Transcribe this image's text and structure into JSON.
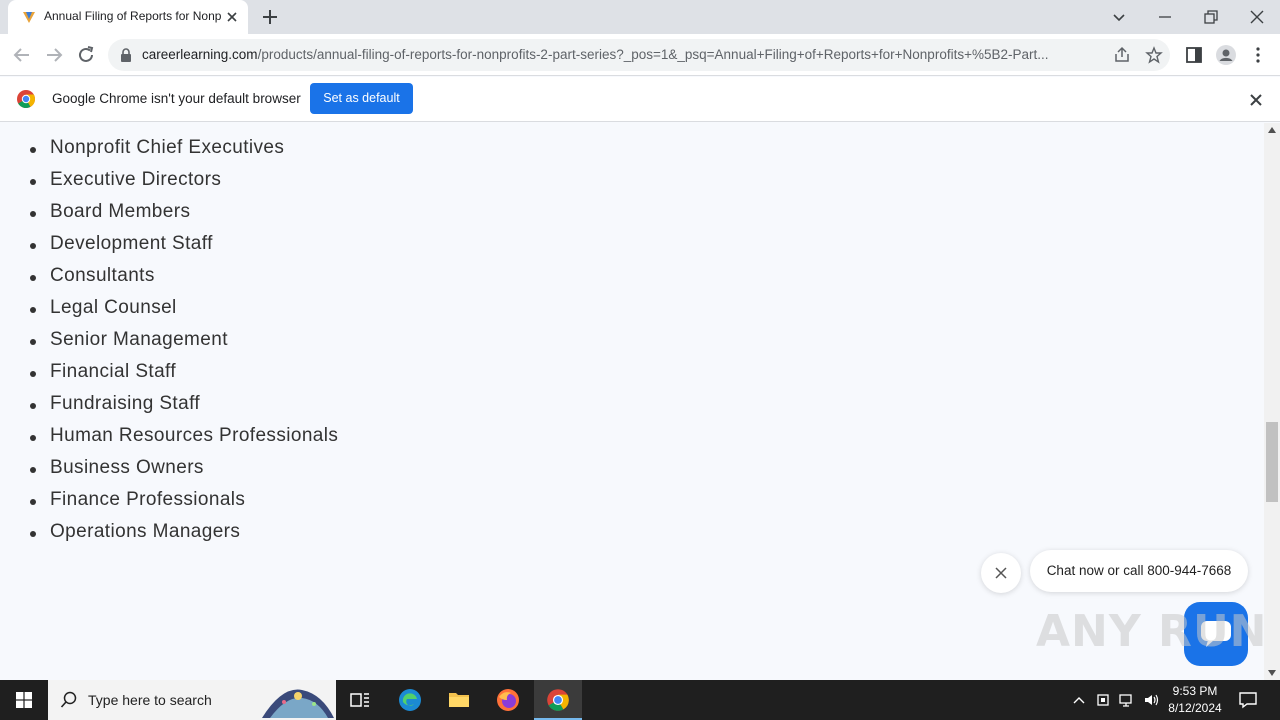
{
  "browser": {
    "tab_title": "Annual Filing of Reports for Nonprofits",
    "url_host": "careerlearning.com",
    "url_path": "/products/annual-filing-of-reports-for-nonprofits-2-part-series?_pos=1&_psq=Annual+Filing+of+Reports+for+Nonprofits+%5B2-Part..."
  },
  "infobar": {
    "message": "Google Chrome isn't your default browser",
    "button_label": "Set as default"
  },
  "audience_list": [
    "Nonprofit Chief Executives",
    "Executive Directors",
    "Board Members",
    "Development Staff",
    "Consultants",
    "Legal Counsel",
    "Senior Management",
    "Financial Staff",
    "Fundraising Staff",
    "Human Resources Professionals",
    "Business Owners",
    "Finance Professionals",
    "Operations Managers"
  ],
  "chat": {
    "bubble_text": "Chat now or call 800-944-7668"
  },
  "watermark": "ANY RUN",
  "taskbar": {
    "search_placeholder": "Type here to search",
    "time": "9:53 PM",
    "date": "8/12/2024"
  },
  "colors": {
    "accent": "#1a73e8",
    "page_bg": "#f7f9fd",
    "taskbar_bg": "#1f1f1f"
  }
}
